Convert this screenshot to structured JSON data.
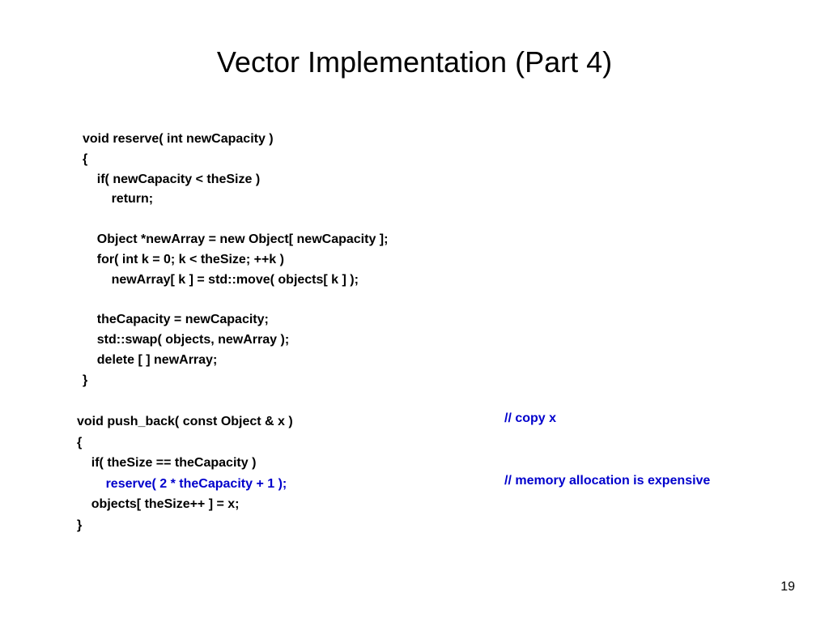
{
  "slide": {
    "title": "Vector Implementation (Part 4)",
    "page_number": "19"
  },
  "reserve": {
    "l1": "void reserve( int newCapacity )",
    "l2": "{",
    "l3": "    if( newCapacity < theSize )",
    "l4": "        return;",
    "l5": "",
    "l6": "    Object *newArray = new Object[ newCapacity ];",
    "l7": "    for( int k = 0; k < theSize; ++k )",
    "l8": "        newArray[ k ] = std::move( objects[ k ] );",
    "l9": "",
    "l10": "    theCapacity = newCapacity;",
    "l11": "    std::swap( objects, newArray );",
    "l12": "    delete [ ] newArray;",
    "l13": "}"
  },
  "push_back": {
    "l1": "void push_back( const Object & x )",
    "l2": "{",
    "l3": "    if( theSize == theCapacity )",
    "l4_indent": "        ",
    "l4_blue": "reserve( 2 * theCapacity + 1 );",
    "l5": "    objects[ theSize++ ] = x;",
    "l6": "}"
  },
  "comments": {
    "copy_x": "// copy x",
    "mem_alloc": "// memory allocation is expensive"
  }
}
